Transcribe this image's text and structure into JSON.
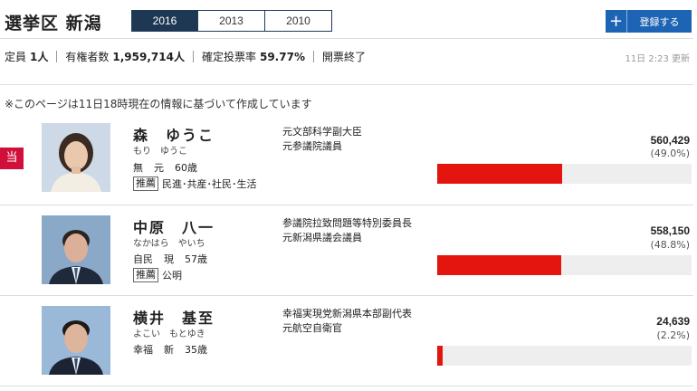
{
  "header": {
    "title": "選挙区 新潟",
    "tabs": [
      {
        "label": "2016",
        "active": true
      },
      {
        "label": "2013",
        "active": false
      },
      {
        "label": "2010",
        "active": false
      }
    ],
    "register_button": {
      "icon": "plus-icon",
      "label": "登録する"
    }
  },
  "stats": {
    "seats_label": "定員",
    "seats_value": "1人",
    "voters_label": "有権者数",
    "voters_value": "1,959,714人",
    "turnout_label": "確定投票率",
    "turnout_value": "59.77%",
    "status": "開票終了",
    "updated": "11日 2:23 更新"
  },
  "note": "※このページは11日18時現在の情報に基づいて作成しています",
  "winner_badge": "当",
  "candidates": [
    {
      "name": "森　ゆうこ",
      "kana": "もり　ゆうこ",
      "party": "無",
      "status": "元",
      "age": "60歳",
      "rec_label": "推薦",
      "recommenders": "民進･共産･社民･生活",
      "career": [
        "元文部科学副大臣",
        "元参議院議員"
      ],
      "votes": "560,429",
      "pct": "(49.0%)",
      "share": 0.49,
      "elected": true
    },
    {
      "name": "中原　八一",
      "kana": "なかはら　やいち",
      "party": "自民",
      "status": "現",
      "age": "57歳",
      "rec_label": "推薦",
      "recommenders": "公明",
      "career": [
        "参議院拉致問題等特別委員長",
        "元新潟県議会議員"
      ],
      "votes": "558,150",
      "pct": "(48.8%)",
      "share": 0.488,
      "elected": false
    },
    {
      "name": "横井　基至",
      "kana": "よこい　もとゆき",
      "party": "幸福",
      "status": "新",
      "age": "35歳",
      "rec_label": "",
      "recommenders": "",
      "career": [
        "幸福実現党新潟県本部副代表",
        "元航空自衛官"
      ],
      "votes": "24,639",
      "pct": "(2.2%)",
      "share": 0.022,
      "elected": false
    }
  ],
  "colors": {
    "bar": "#e4140e",
    "winner": "#d0103a",
    "tab_active": "#1e3854",
    "register": "#1e64b4"
  }
}
